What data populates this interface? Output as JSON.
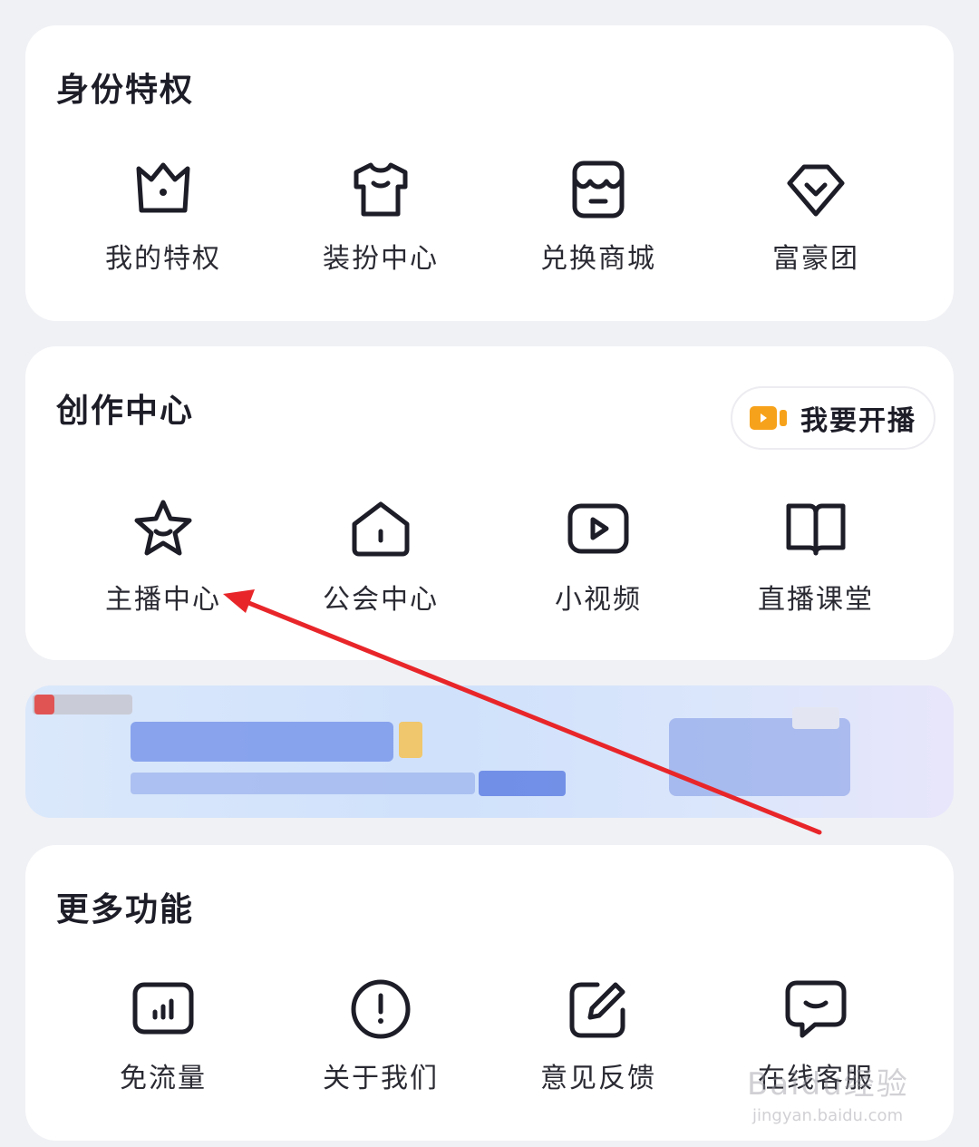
{
  "identity": {
    "title": "身份特权",
    "items": [
      {
        "label": "我的特权",
        "icon": "crown-icon"
      },
      {
        "label": "装扮中心",
        "icon": "tshirt-icon"
      },
      {
        "label": "兑换商城",
        "icon": "store-icon"
      },
      {
        "label": "富豪团",
        "icon": "diamond-icon"
      }
    ]
  },
  "creation": {
    "title": "创作中心",
    "live_button": {
      "label": "我要开播",
      "icon": "video-camera-icon"
    },
    "items": [
      {
        "label": "主播中心",
        "icon": "star-icon"
      },
      {
        "label": "公会中心",
        "icon": "house-icon"
      },
      {
        "label": "小视频",
        "icon": "play-icon"
      },
      {
        "label": "直播课堂",
        "icon": "book-icon"
      }
    ]
  },
  "more": {
    "title": "更多功能",
    "items": [
      {
        "label": "免流量",
        "icon": "signal-bars-icon"
      },
      {
        "label": "关于我们",
        "icon": "info-icon"
      },
      {
        "label": "意见反馈",
        "icon": "edit-icon"
      },
      {
        "label": "在线客服",
        "icon": "chat-icon"
      }
    ]
  },
  "annotation": {
    "color": "#e8262a"
  },
  "watermark": {
    "brand": "Baidu经验",
    "url": "jingyan.baidu.com"
  },
  "colors": {
    "page_bg": "#f0f1f5",
    "card_bg": "#ffffff",
    "icon_stroke": "#1d1d28",
    "accent_orange": "#f7a21b"
  }
}
